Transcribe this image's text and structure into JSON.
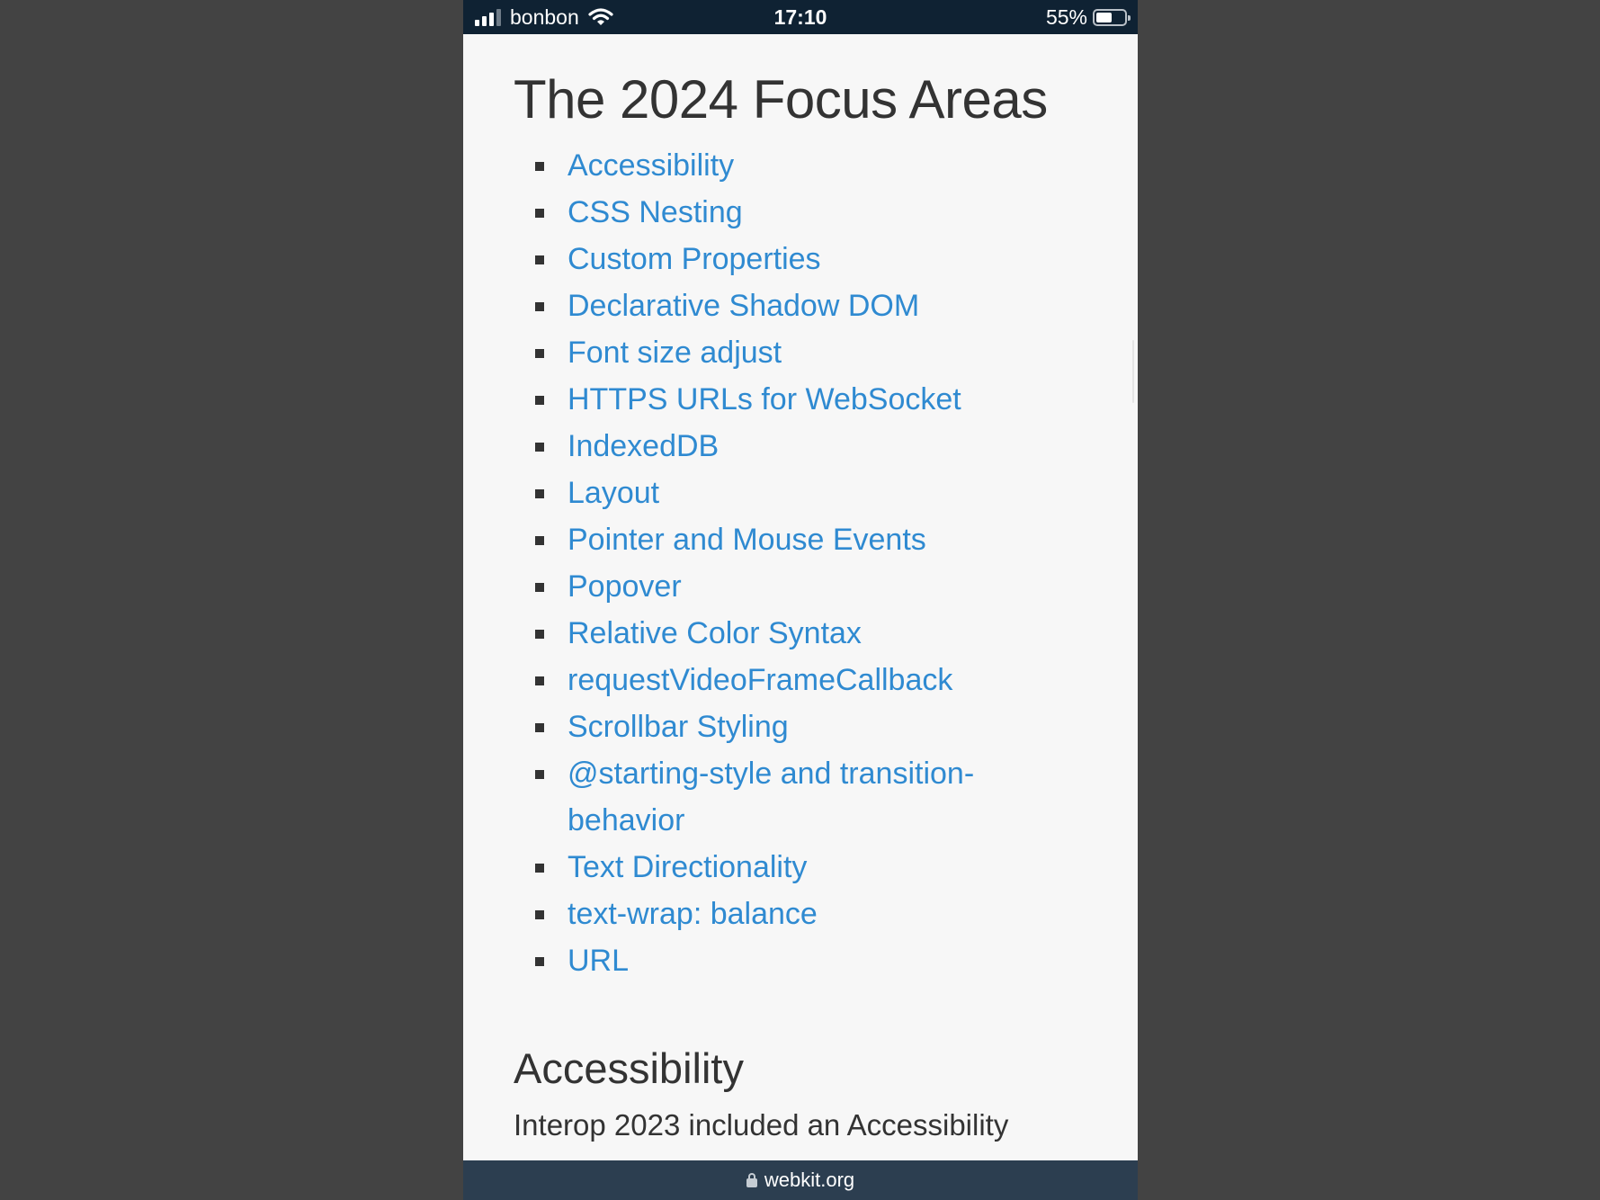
{
  "status_bar": {
    "carrier": "bonbon",
    "time": "17:10",
    "battery_percent": "55%",
    "battery_level": 0.55,
    "signal_bars": 3,
    "icons": [
      "signal-icon",
      "wifi-icon",
      "battery-icon"
    ]
  },
  "page": {
    "title": "The 2024 Focus Areas",
    "focus_areas": [
      "Accessibility",
      "CSS Nesting",
      "Custom Properties",
      "Declarative Shadow DOM",
      "Font size adjust",
      "HTTPS URLs for WebSocket",
      "IndexedDB",
      "Layout",
      "Pointer and Mouse Events",
      "Popover",
      "Relative Color Syntax",
      "requestVideoFrameCallback",
      "Scrollbar Styling",
      "@starting-style and transition-behavior",
      "Text Directionality",
      "text-wrap: balance",
      "URL"
    ],
    "section_heading": "Accessibility",
    "section_intro": "Interop 2023 included an Accessibility"
  },
  "url_bar": {
    "domain": "webkit.org",
    "icon": "lock-icon"
  },
  "colors": {
    "link": "#2f8ad1",
    "text": "#333333",
    "status_bar_bg": "#0f2233",
    "url_bar_bg": "#2c3e50",
    "outer_bg": "#434343"
  }
}
